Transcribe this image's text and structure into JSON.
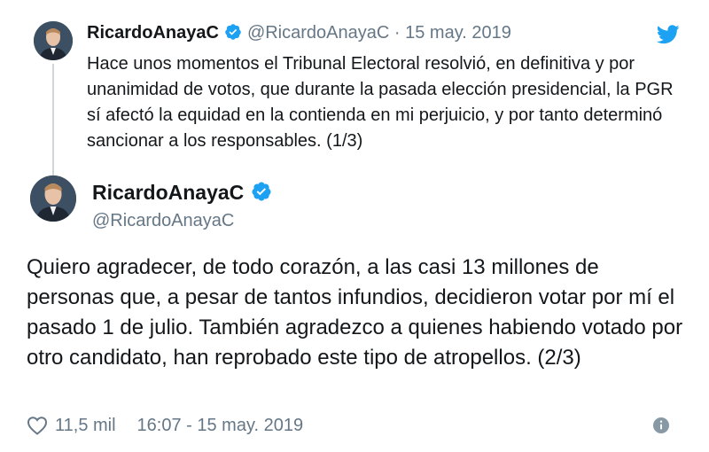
{
  "quoted_tweet": {
    "name": "RicardoAnayaC",
    "handle": "@RicardoAnayaC",
    "separator": "·",
    "date": "15 may. 2019",
    "text": "Hace unos momentos el Tribunal Electoral resolvió, en definitiva y por unanimidad de votos, que durante la pasada elección presidencial, la PGR sí afectó la equidad en la contienda en mi perjuicio, y por tanto determinó sancionar a los responsables. (1/3)"
  },
  "main_tweet": {
    "name": "RicardoAnayaC",
    "handle": "@RicardoAnayaC",
    "text": "Quiero agradecer, de todo corazón, a las casi 13 millones de personas que, a pesar de tantos infundios, decidieron votar por mí el pasado 1 de julio. También agradezco a quienes habiendo votado por otro candidato, han reprobado este tipo de atropellos. (2/3)",
    "like_count": "11,5 mil",
    "timestamp": "16:07 - 15 may. 2019"
  },
  "icons": {
    "brand": "twitter-bird-icon",
    "verified": "verified-badge-icon",
    "like": "heart-icon",
    "info": "info-icon"
  },
  "colors": {
    "twitter_blue": "#1da1f2",
    "text_primary": "#14171a",
    "text_secondary": "#657786",
    "thread_line": "#ccd6dd"
  }
}
